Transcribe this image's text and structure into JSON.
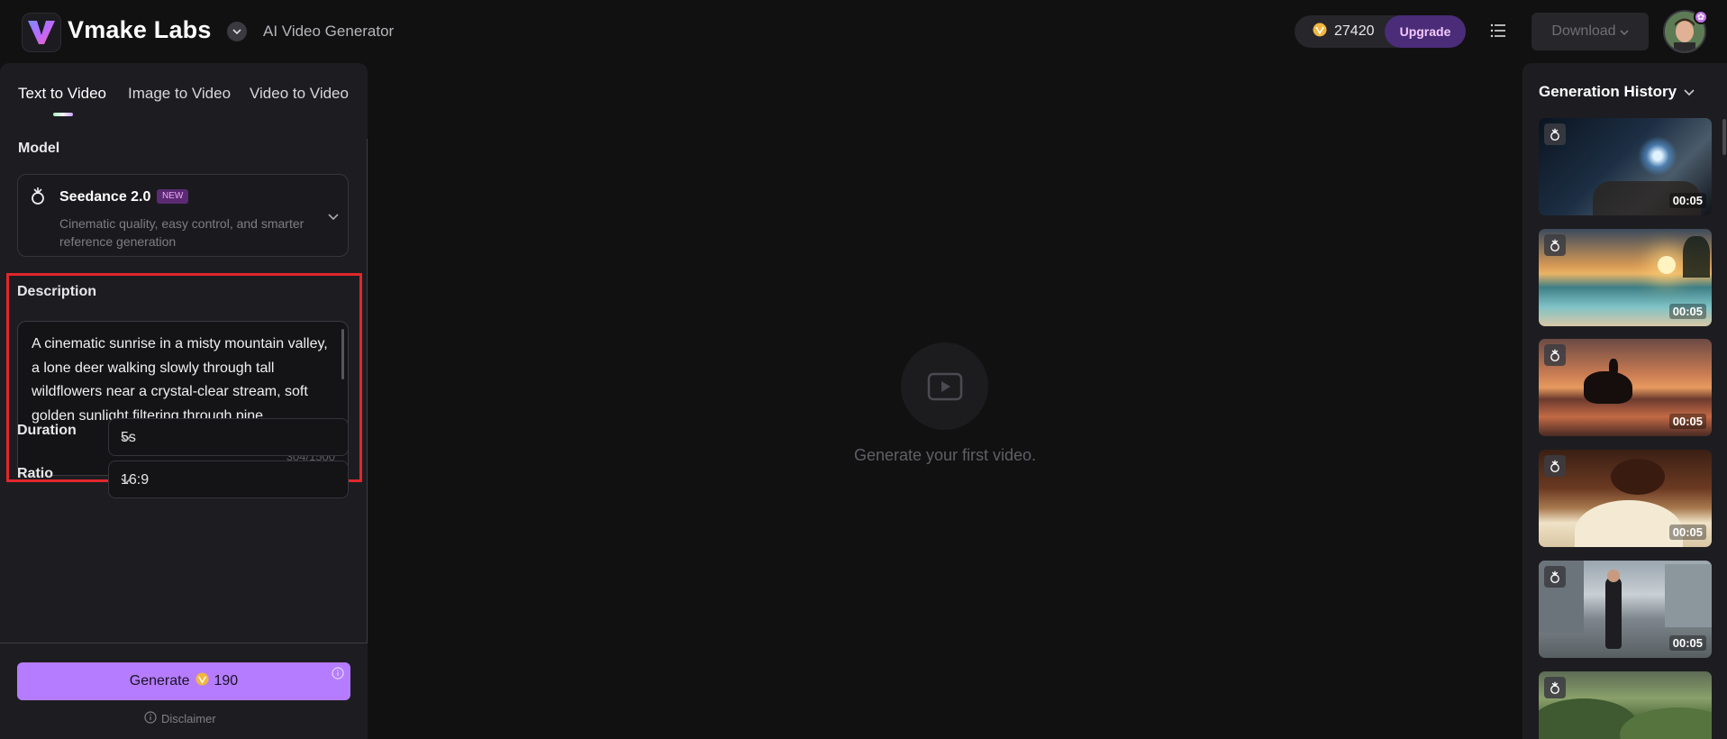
{
  "header": {
    "brand": "Vmake Labs",
    "subtitle": "AI Video Generator",
    "credits": "27420",
    "upgrade_label": "Upgrade",
    "download_label": "Download"
  },
  "tabs": [
    {
      "label": "Text to Video",
      "active": true
    },
    {
      "label": "Image to Video",
      "active": false
    },
    {
      "label": "Video to Video",
      "active": false
    }
  ],
  "model": {
    "section_label": "Model",
    "name": "Seedance 2.0",
    "badge": "NEW",
    "description": "Cinematic quality, easy control, and smarter reference generation"
  },
  "description": {
    "section_label": "Description",
    "text": "A cinematic sunrise in a misty mountain valley, a lone deer walking slowly through tall wildflowers near a crystal-clear stream, soft golden sunlight filtering through pine",
    "count": "304/1500"
  },
  "duration": {
    "label": "Duration",
    "value": "5s"
  },
  "ratio": {
    "label": "Ratio",
    "value": "16:9"
  },
  "generate": {
    "label": "Generate",
    "cost": "190"
  },
  "disclaimer": "Disclaimer",
  "empty_state": "Generate your first video.",
  "history": {
    "title": "Generation History",
    "items": [
      {
        "duration": "00:05"
      },
      {
        "duration": "00:05"
      },
      {
        "duration": "00:05"
      },
      {
        "duration": "00:05"
      },
      {
        "duration": "00:05"
      },
      {
        "duration": ""
      }
    ]
  },
  "colors": {
    "accent": "#b57cff",
    "highlight_border": "#e0272b",
    "background": "#111112",
    "panel": "#1d1d21"
  }
}
